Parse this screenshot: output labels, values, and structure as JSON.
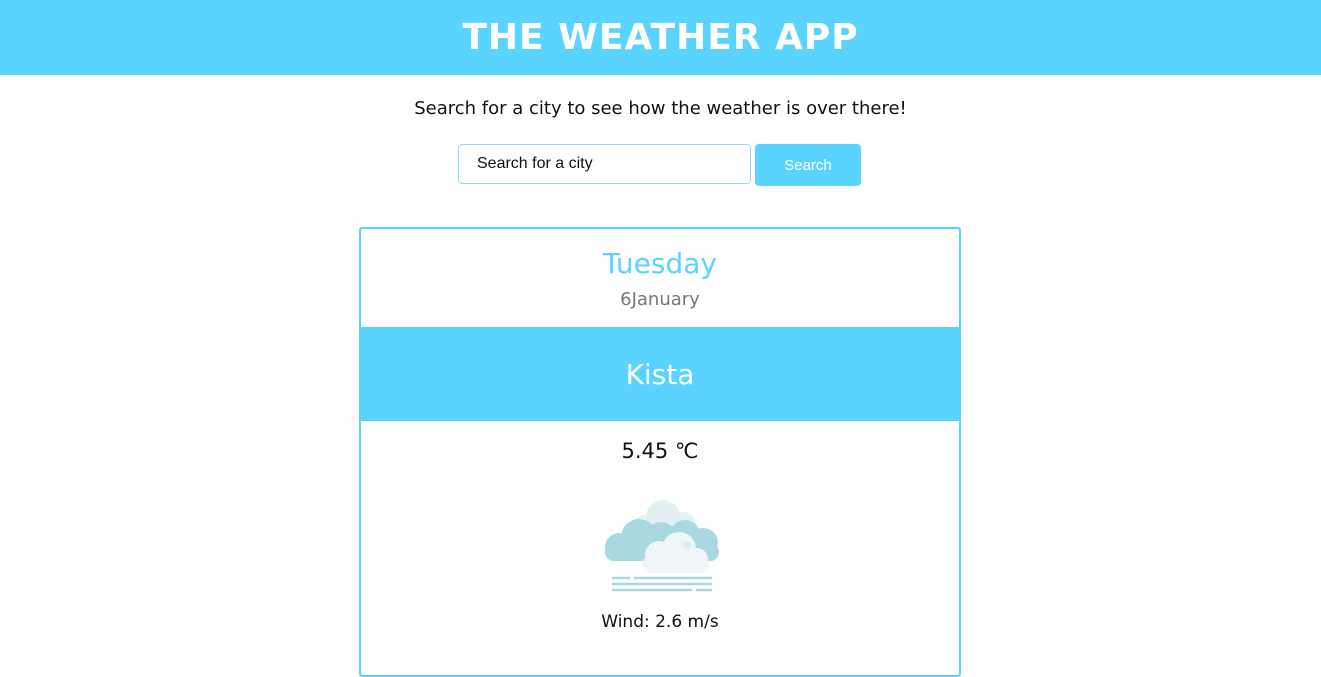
{
  "app": {
    "title": "THE WEATHER APP"
  },
  "search": {
    "tagline": "Search for a city to see how the weather is over there!",
    "placeholder": "Search for a city",
    "button_label": "Search"
  },
  "forecast": {
    "day": "Tuesday",
    "date": "6January",
    "city": "Kista",
    "temperature": "5.45 ℃",
    "icon": "cloudy-fog-icon",
    "wind": "Wind: 2.6 m/s"
  },
  "colors": {
    "accent": "#5bd3ff",
    "date_gray": "#777777",
    "cloud_dark": "#a9d8e0",
    "cloud_light": "#eef6f8"
  }
}
